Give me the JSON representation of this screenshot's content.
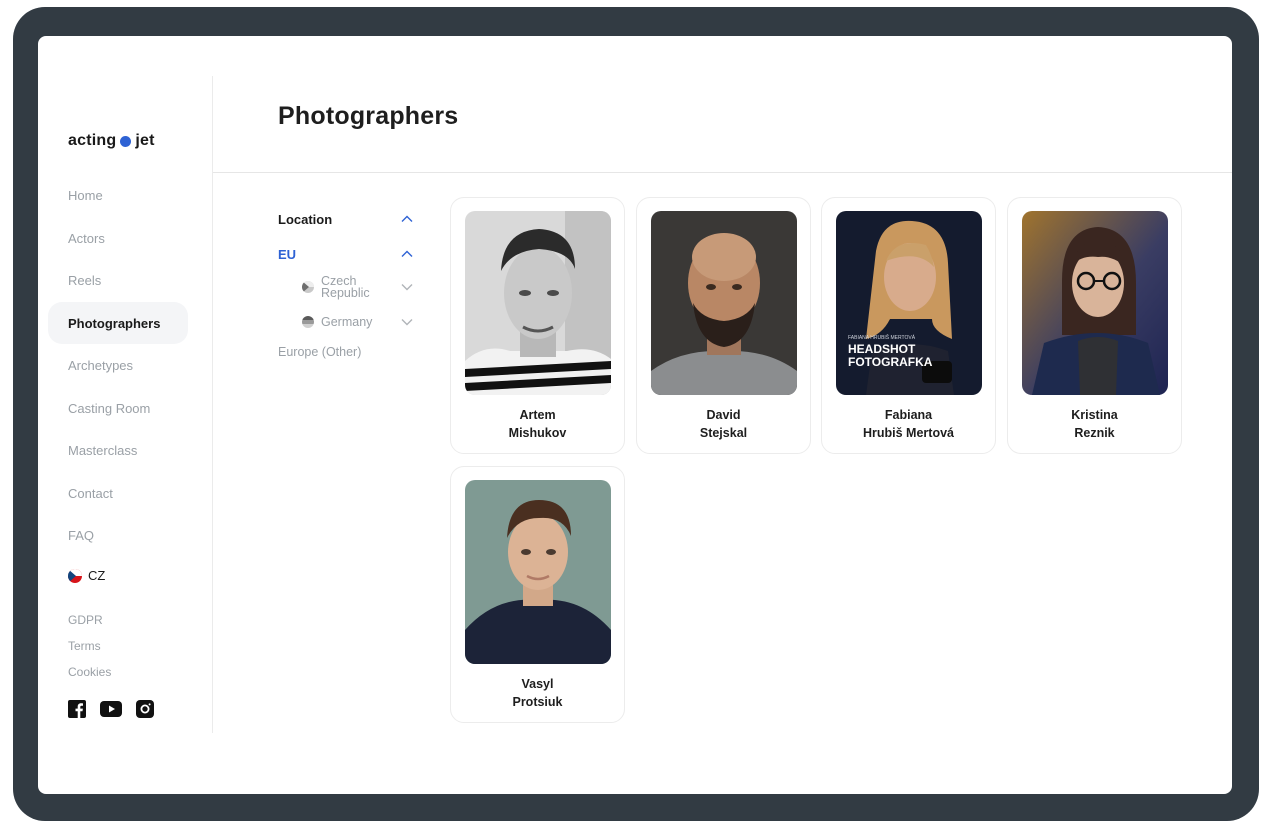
{
  "brand": {
    "left": "acting",
    "right": "jet",
    "dot_color": "#2e62d4"
  },
  "nav": {
    "items": [
      {
        "label": "Home"
      },
      {
        "label": "Actors"
      },
      {
        "label": "Reels"
      },
      {
        "label": "Photographers",
        "active": true
      },
      {
        "label": "Archetypes"
      },
      {
        "label": "Casting Room"
      },
      {
        "label": "Masterclass"
      },
      {
        "label": "Contact"
      },
      {
        "label": "FAQ"
      }
    ]
  },
  "language": {
    "code": "CZ",
    "flag": "czech-flag"
  },
  "legal": {
    "gdpr": "GDPR",
    "terms": "Terms",
    "cookies": "Cookies"
  },
  "social": {
    "icons": [
      "facebook-icon",
      "youtube-icon",
      "instagram-icon"
    ]
  },
  "page": {
    "title": "Photographers"
  },
  "filter": {
    "location_label": "Location",
    "region_label": "EU",
    "countries": [
      {
        "name_line1": "Czech",
        "name_line2": "Republic",
        "flag": "czech-flag"
      },
      {
        "name_line1": "Germany",
        "flag": "german-flag"
      }
    ],
    "other_label": "Europe (Other)"
  },
  "photographers": [
    {
      "first": "Artem",
      "last": "Mishukov",
      "photo": "portrait-black-and-white"
    },
    {
      "first": "David",
      "last": "Stejskal",
      "photo": "portrait-bald-man"
    },
    {
      "first": "Fabiana",
      "last": "Hrubiš Mertová",
      "photo": "portrait-headshot-fotografka",
      "photo_text": {
        "small": "FABIANA HRUBIŠ MERTOVÁ",
        "line1": "HEADSHOT",
        "line2": "FOTOGRAFKA"
      }
    },
    {
      "first": "Kristina",
      "last": "Reznik",
      "photo": "portrait-woman-glasses"
    },
    {
      "first": "Vasyl",
      "last": "Protsiuk",
      "photo": "portrait-young-man"
    }
  ],
  "colors": {
    "accent": "#2e62d4",
    "frame": "#323b43",
    "muted_text": "#9aa0a6"
  }
}
